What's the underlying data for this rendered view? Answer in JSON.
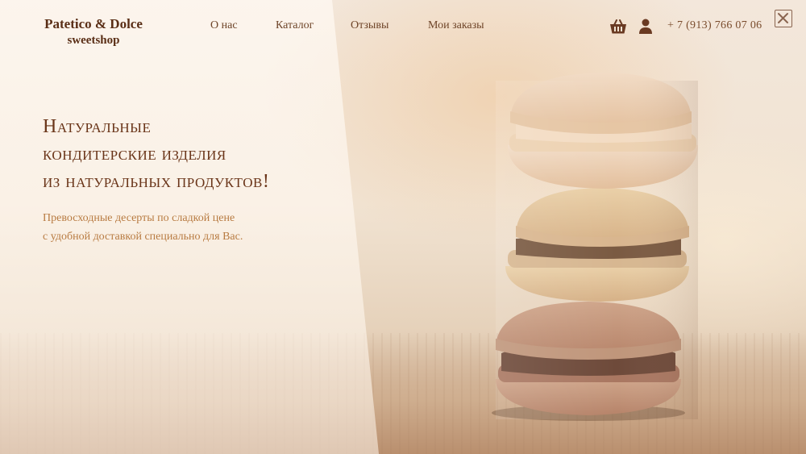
{
  "brand": {
    "name": "Patetico & Dolce",
    "tagline": "sweetshop"
  },
  "nav": [
    {
      "label": "О нас"
    },
    {
      "label": "Каталог"
    },
    {
      "label": "Отзывы"
    },
    {
      "label": "Мои заказы"
    }
  ],
  "header": {
    "cart_icon": "basket-icon",
    "user_icon": "user-icon",
    "phone": "+ 7 (913) 766 07 06",
    "close_icon": "close-icon"
  },
  "hero": {
    "headline": [
      "Натуральные",
      "кондитерские изделия",
      "из натуральных продуктов!"
    ],
    "subtitle": [
      "Превосходные десерты по сладкой цене",
      "с удобной доставкой специально для Вас."
    ]
  },
  "colors": {
    "brand": "#5a2e16",
    "headline": "#6a3519",
    "accent": "#b87b42",
    "icon": "#6a3a22"
  }
}
